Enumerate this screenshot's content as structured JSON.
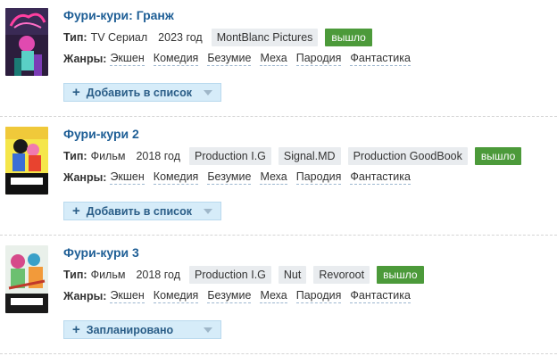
{
  "labels": {
    "type": "Тип:",
    "genres": "Жанры:"
  },
  "colors": {
    "title": "#1f5f96",
    "status_released": "#4c9a3a",
    "button_bg": "#d6ecf9",
    "studio_bg": "#e9ecef"
  },
  "items": [
    {
      "title": "Фури-кури: Гранж",
      "type": "TV Сериал",
      "year": "2023 год",
      "studios": [
        "MontBlanc Pictures"
      ],
      "status": "вышло",
      "genres": [
        "Экшен",
        "Комедия",
        "Безумие",
        "Меха",
        "Пародия",
        "Фантастика"
      ],
      "list_button": {
        "icon": "plus-icon",
        "label": "Добавить в список"
      }
    },
    {
      "title": "Фури-кури 2",
      "type": "Фильм",
      "year": "2018 год",
      "studios": [
        "Production I.G",
        "Signal.MD",
        "Production GoodBook"
      ],
      "status": "вышло",
      "genres": [
        "Экшен",
        "Комедия",
        "Безумие",
        "Меха",
        "Пародия",
        "Фантастика"
      ],
      "list_button": {
        "icon": "plus-icon",
        "label": "Добавить в список"
      }
    },
    {
      "title": "Фури-кури 3",
      "type": "Фильм",
      "year": "2018 год",
      "studios": [
        "Production I.G",
        "Nut",
        "Revoroot"
      ],
      "status": "вышло",
      "genres": [
        "Экшен",
        "Комедия",
        "Безумие",
        "Меха",
        "Пародия",
        "Фантастика"
      ],
      "list_button": {
        "icon": "plus-icon",
        "label": "Запланировано"
      }
    }
  ]
}
